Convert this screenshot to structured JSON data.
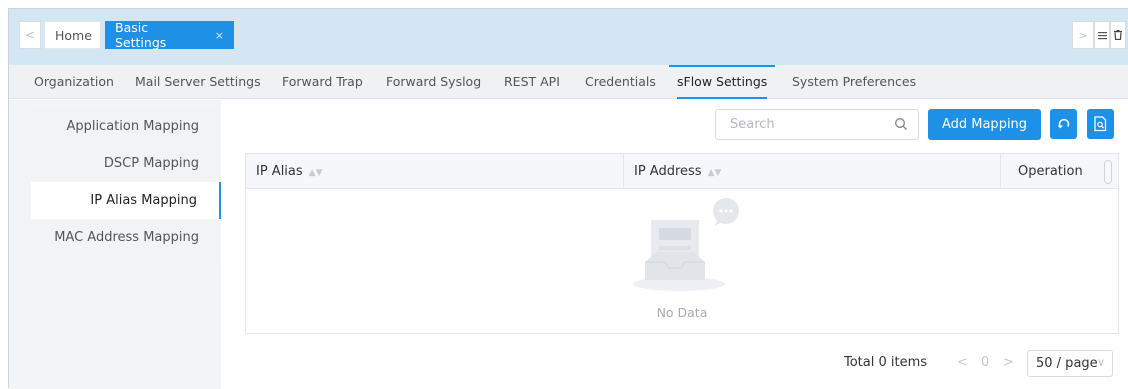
{
  "page_tabs": {
    "prev_label": "<",
    "home": "Home",
    "active": "Basic Settings",
    "close": "×",
    "next_label": ">"
  },
  "settings_tabs": [
    "Organization",
    "Mail Server Settings",
    "Forward Trap",
    "Forward Syslog",
    "REST API",
    "Credentials",
    "sFlow Settings",
    "System Preferences"
  ],
  "active_settings_tab": "sFlow Settings",
  "sidebar": {
    "items": [
      "Application Mapping",
      "DSCP Mapping",
      "IP Alias Mapping",
      "MAC Address Mapping"
    ],
    "active": "IP Alias Mapping"
  },
  "toolbar": {
    "search_placeholder": "Search",
    "add_button": "Add Mapping"
  },
  "table": {
    "columns": [
      "IP Alias",
      "IP Address",
      "Operation"
    ],
    "rows": [],
    "empty_text": "No Data"
  },
  "pagination": {
    "total": "Total 0 items",
    "prev": "<",
    "current_page": "0",
    "next": ">",
    "page_size": "50 / page"
  },
  "colors": {
    "accent": "#1e90e6",
    "tabbar_bg": "#d3e6f3"
  }
}
